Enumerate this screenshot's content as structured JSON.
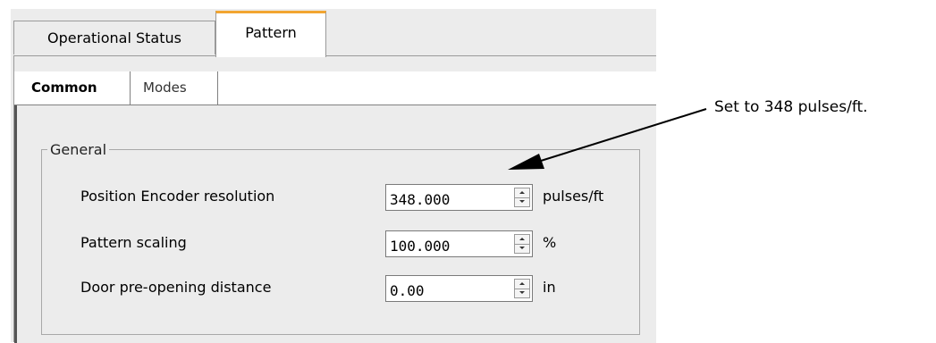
{
  "tabs": {
    "outer": [
      {
        "label": "Operational Status",
        "active": false
      },
      {
        "label": "Pattern",
        "active": true
      }
    ],
    "inner": [
      {
        "label": "Common",
        "active": true
      },
      {
        "label": "Modes",
        "active": false
      }
    ]
  },
  "group": {
    "title": "General",
    "rows": [
      {
        "label": "Position Encoder resolution",
        "value": "348.000",
        "unit": "pulses/ft"
      },
      {
        "label": "Pattern scaling",
        "value": "100.000",
        "unit": "%"
      },
      {
        "label": "Door pre-opening distance",
        "value": "0.00",
        "unit": "in"
      }
    ]
  },
  "annotation": {
    "text": "Set to 348 pulses/ft."
  },
  "colors": {
    "active_tab_accent": "#f2a531",
    "panel_bg": "#ececec"
  }
}
